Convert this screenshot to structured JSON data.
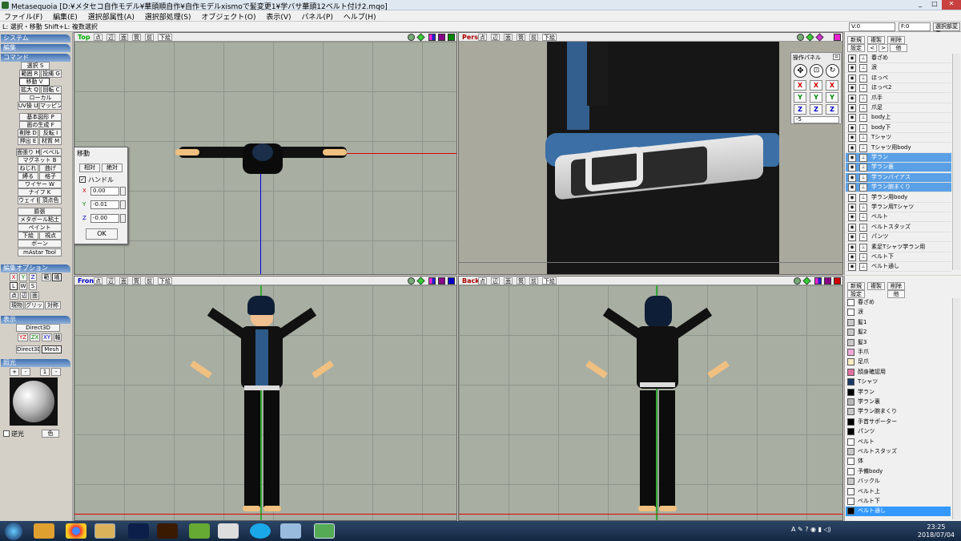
{
  "window": {
    "title": "Metasequoia [D:¥メタセコ自作モデル¥華頭順自作¥自作モデルxismoで髪変更1¥学バサ華頭12ベルト付け2.mqo]"
  },
  "menu": [
    "ファイル(F)",
    "編集(E)",
    "選択部属性(A)",
    "選択部処理(S)",
    "オブジェクト(O)",
    "表示(V)",
    "パネル(P)",
    "ヘルプ(H)"
  ],
  "status": {
    "hint": "L: 選択・移動  Shift+L: 複数選択",
    "v": "V:0",
    "f": "F:0",
    "deselect": "選択部変更"
  },
  "left": {
    "system": "システム",
    "edit": "編集",
    "command": "コマンド",
    "cmd": [
      "選択 S",
      "範囲 R",
      "投縄 G",
      "移動 V",
      "拡大 Q",
      "回転 C",
      "ローカル",
      "UV操 U",
      "マッピング",
      "基本図形 P",
      "面の生成 F",
      "削除 D",
      "反転 I",
      "押出 E",
      "材質 M",
      "面張り H",
      "ベベル",
      "マグネット B",
      "ねじれ",
      "曲げ",
      "縛る",
      "格子",
      "ワイヤー W",
      "ナイフ K",
      "ウェイト",
      "頂点色",
      "膨張",
      "メタボール粘土",
      "ペイント",
      "下絵",
      "視点",
      "ボーン",
      "mAstar Tool"
    ],
    "editopt": "編集オプション",
    "axis": [
      "X",
      "Y",
      "Z",
      "範",
      "繊",
      "L",
      "W",
      "S",
      "点",
      "辺",
      "面",
      "現物",
      "グリッド",
      "対称"
    ],
    "display": "表示",
    "direct3d": "Direct3D",
    "axes": [
      "YZ",
      "ZX",
      "XY",
      "軸"
    ],
    "d3d": "Direct3D",
    "mesh": "Mesh",
    "light": "照光",
    "lightbtns": [
      "+",
      "-",
      "1",
      "-"
    ],
    "backlight": "逆光",
    "color": "色"
  },
  "vp": {
    "top": "Top",
    "pers": "Pers",
    "front": "Front",
    "back": "Back",
    "tabs": [
      "点",
      "辺",
      "面",
      "筒",
      "前",
      "下絵"
    ]
  },
  "dialog": {
    "title": "移動",
    "rel": "相対",
    "abs": "絶対",
    "handle": "ハンドル",
    "x": "0.00",
    "y": "-0.01",
    "z": "-0.00",
    "ok": "OK",
    "xl": "X",
    "yl": "Y",
    "zl": "Z"
  },
  "oppanel": {
    "title": "操作パネル",
    "value": "-5",
    "rows": [
      [
        "X",
        "X",
        "X"
      ],
      [
        "Y",
        "Y",
        "Y"
      ],
      [
        "Z",
        "Z",
        "Z"
      ]
    ]
  },
  "objpanel": {
    "new": "新規",
    "dup": "複製",
    "del": "削除",
    "set": "設定",
    "prev": "<",
    "next": ">",
    "color": "他",
    "items": [
      {
        "name": "春ざめ",
        "sel": false
      },
      {
        "name": "涙",
        "sel": false
      },
      {
        "name": "ほっぺ",
        "sel": false
      },
      {
        "name": "ほっぺ2",
        "sel": false
      },
      {
        "name": "爪手",
        "sel": false
      },
      {
        "name": "爪足",
        "sel": false
      },
      {
        "name": "body上",
        "sel": false
      },
      {
        "name": "body下",
        "sel": false
      },
      {
        "name": "Tシャツ",
        "sel": false
      },
      {
        "name": "Tシャツ用body",
        "sel": false
      },
      {
        "name": "学ラン",
        "sel": true
      },
      {
        "name": "学ラン裏",
        "sel": true
      },
      {
        "name": "学ランバイアス",
        "sel": true
      },
      {
        "name": "学ラン腕まくり",
        "sel": true
      },
      {
        "name": "学ラン用body",
        "sel": false
      },
      {
        "name": "学ラン用Tシャツ",
        "sel": false
      },
      {
        "name": "ベルト",
        "sel": false
      },
      {
        "name": "ベルトスタッズ",
        "sel": false
      },
      {
        "name": "パンツ",
        "sel": false
      },
      {
        "name": "素足Tシャツ学ラン用",
        "sel": false
      },
      {
        "name": "ベルト下",
        "sel": false
      },
      {
        "name": "ベルト通し",
        "sel": false
      }
    ]
  },
  "matpanel": {
    "new": "新規",
    "dup": "複製",
    "del": "削除",
    "set": "設定",
    "color": "他",
    "items": [
      {
        "name": "春ざめ",
        "color": "#ffffff"
      },
      {
        "name": "涙",
        "color": "#ffffff"
      },
      {
        "name": "髪1",
        "color": "#c8c8c8"
      },
      {
        "name": "髪2",
        "color": "#c8c8c8"
      },
      {
        "name": "髪3",
        "color": "#c8c8c8"
      },
      {
        "name": "手爪",
        "color": "#f0a8d8"
      },
      {
        "name": "足爪",
        "color": "#f8ecc0"
      },
      {
        "name": "顔身確認用",
        "color": "#e070a0"
      },
      {
        "name": "Tシャツ",
        "color": "#1a3a66"
      },
      {
        "name": "学ラン",
        "color": "#000000"
      },
      {
        "name": "学ラン裏",
        "color": "#b8b8b8"
      },
      {
        "name": "学ラン腕まくり",
        "color": "#c8c8c8"
      },
      {
        "name": "手首サポーター",
        "color": "#000000"
      },
      {
        "name": "パンツ",
        "color": "#000000"
      },
      {
        "name": "ベルト",
        "color": "#ffffff"
      },
      {
        "name": "ベルトスタッズ",
        "color": "#c8c8c8"
      },
      {
        "name": "体",
        "color": "#ffffff"
      },
      {
        "name": "予備body",
        "color": "#ffffff"
      },
      {
        "name": "バックル",
        "color": "#c8c8c8"
      },
      {
        "name": "ベルト上",
        "color": "#ffffff"
      },
      {
        "name": "ベルト下",
        "color": "#ffffff"
      },
      {
        "name": "ベルト通し",
        "color": "#000000"
      }
    ]
  },
  "taskbar": {
    "time": "23:25",
    "date": "2018/07/04"
  }
}
